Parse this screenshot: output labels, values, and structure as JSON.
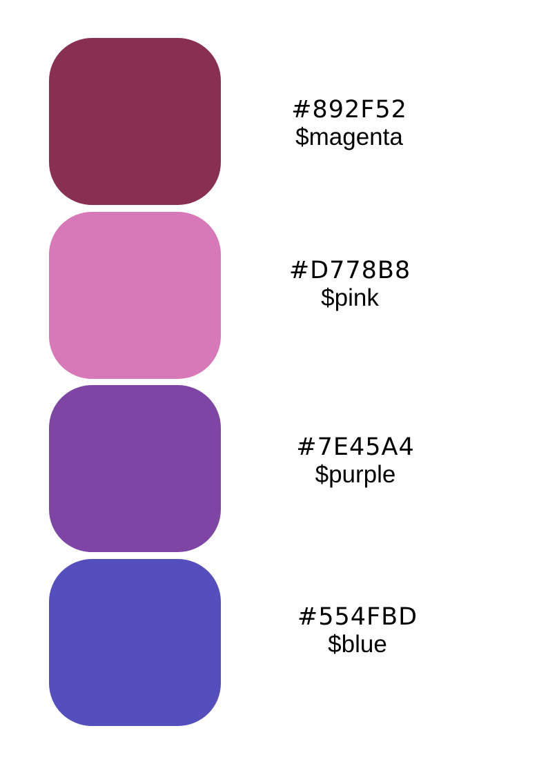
{
  "swatches": [
    {
      "hex": "#892F52",
      "name": "$magenta",
      "color": "#892F52"
    },
    {
      "hex": "#D778B8",
      "name": "$pink",
      "color": "#D778B8"
    },
    {
      "hex": "#7E45A4",
      "name": "$purple",
      "color": "#7E45A4"
    },
    {
      "hex": "#554FBD",
      "name": "$blue",
      "color": "#554FBD"
    }
  ]
}
